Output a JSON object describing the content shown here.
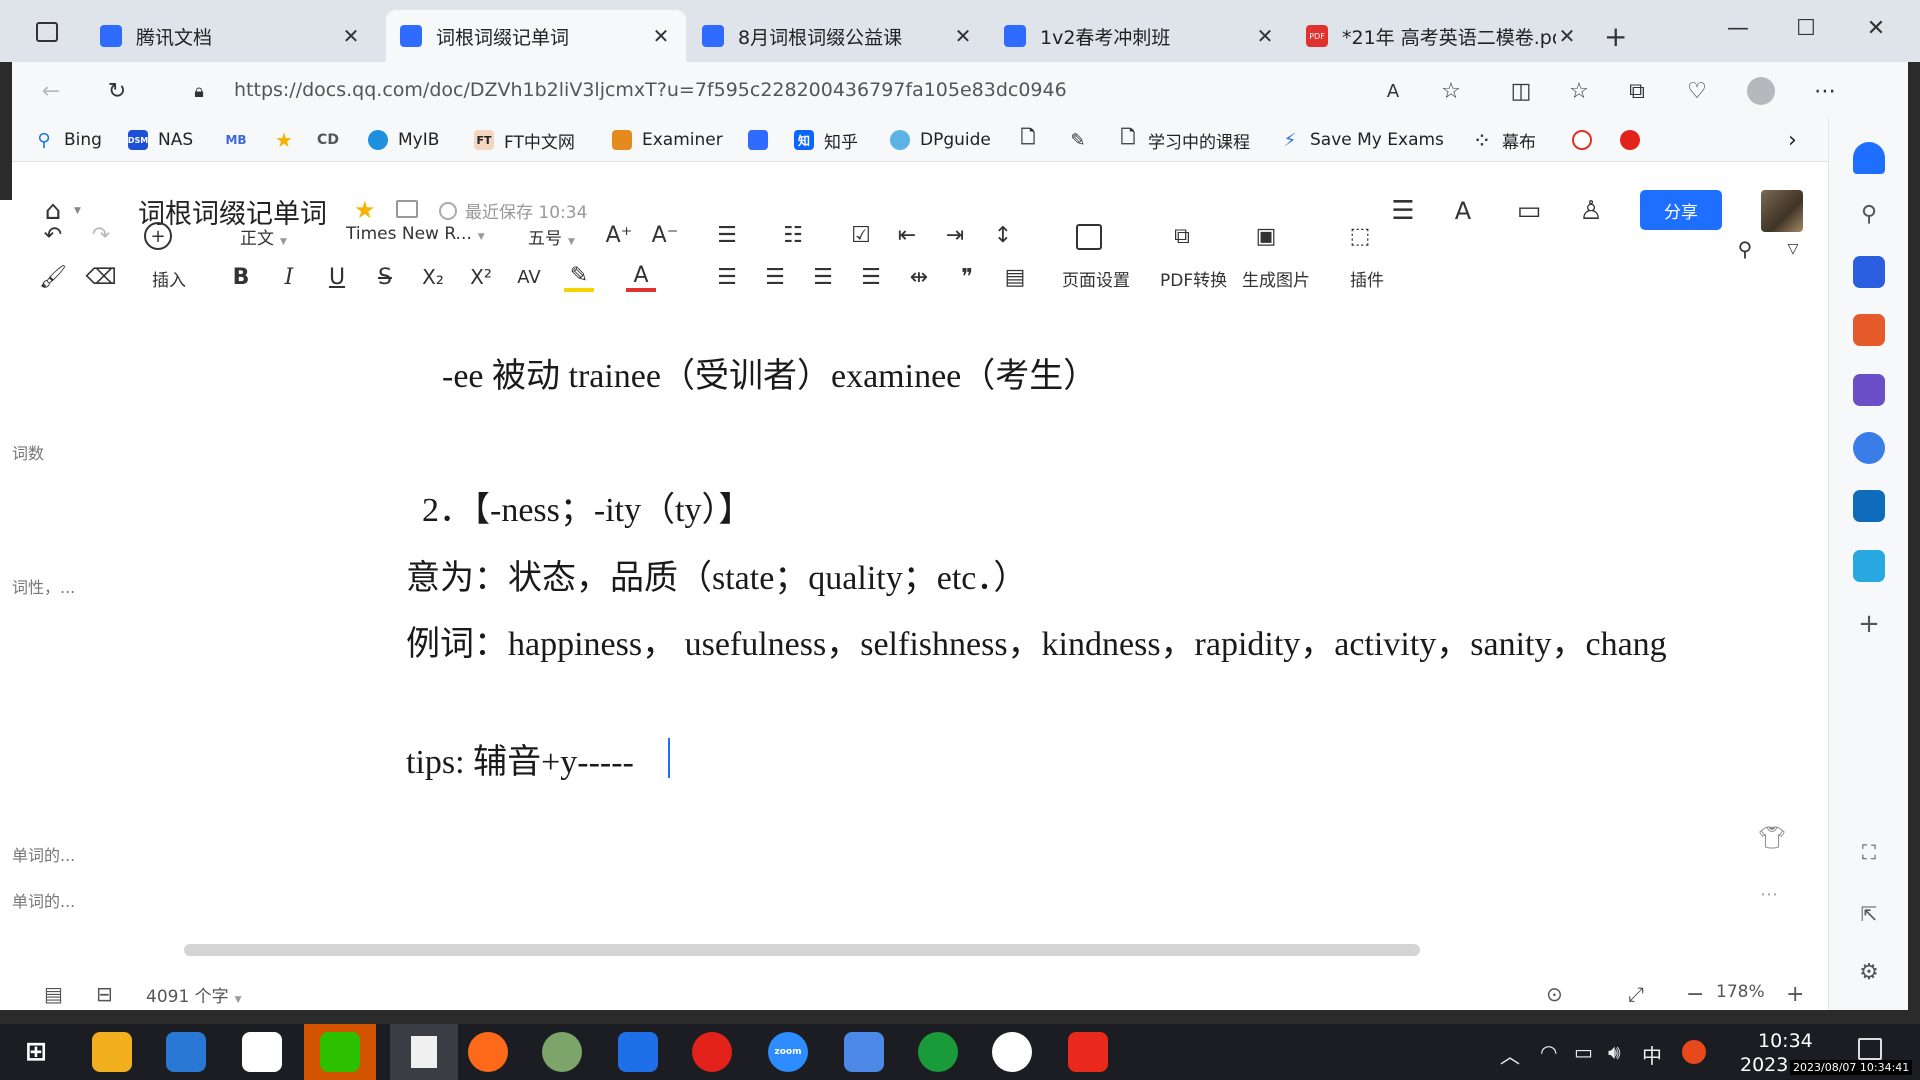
{
  "tabs": [
    {
      "label": "腾讯文档",
      "active": false
    },
    {
      "label": "词根词缀记单词",
      "active": true
    },
    {
      "label": "8月词根词缀公益课",
      "active": false
    },
    {
      "label": "1v2春考冲刺班",
      "active": false
    },
    {
      "label": "*21年 高考英语二模卷.pd",
      "active": false
    }
  ],
  "new_tab": "+",
  "url": "https://docs.qq.com/doc/DZVh1b2liV3ljcmxT?u=7f595c228200436797fa105e83dc0946",
  "bookmarks": [
    "Bing",
    "NAS",
    "MyIB",
    "FT中文网",
    "Examiner",
    "知乎",
    "DPguide",
    "学习中的课程",
    "Save My Exams",
    "幕布"
  ],
  "bookmark_badges": {
    "nas": "DSM",
    "mb": "MB",
    "cd": "CD",
    "ft": "FT",
    "zhihu": "知",
    "pdf": "PDF"
  },
  "doc": {
    "title": "词根词缀记单词",
    "saved": "最近保存 10:34",
    "share": "分享"
  },
  "toolbar": {
    "insert": "插入",
    "style": "正文",
    "font": "Times New R...",
    "size": "五号",
    "page_setup": "页面设置",
    "pdf": "PDF转换",
    "image": "生成图片",
    "plugin": "插件"
  },
  "content": {
    "line1": "-ee 被动 trainee（受训者）examinee（考生）",
    "line2": "2．【-ness；-ity（ty）】",
    "line3": "意为：状态，品质（state；quality；etc．）",
    "line4": "例词：happiness， usefulness，selfishness，kindness，rapidity，activity，sanity，chang",
    "line5": "tips: 辅音+y-----"
  },
  "side_notes": [
    "词数",
    "词性，...",
    "单词的...",
    "单词的..."
  ],
  "status": {
    "word_count": "4091 个字",
    "zoom": "178%"
  },
  "clock": {
    "time": "10:34",
    "date": "2023",
    "stamp": "2023/08/07 10:34:41"
  },
  "taskbar": {
    "ime": "中",
    "zoom_app": "zoom"
  }
}
